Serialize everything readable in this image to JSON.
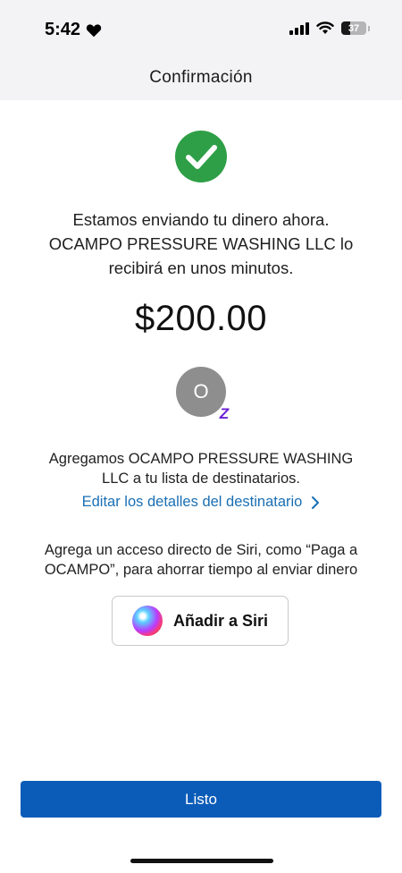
{
  "status_bar": {
    "time": "5:42",
    "battery": "37",
    "icons": [
      "heart-icon",
      "signal-icon",
      "wifi-icon",
      "battery-icon"
    ]
  },
  "nav": {
    "title": "Confirmación"
  },
  "confirmation": {
    "icon": "check-circle-icon",
    "message": "Estamos enviando tu dinero ahora. OCAMPO PRESSURE WASHING LLC lo recibirá en unos minutos.",
    "amount": "$200.00"
  },
  "recipient": {
    "initial": "O",
    "badge_letter": "Z",
    "added_text": "Agregamos OCAMPO PRESSURE WASHING LLC a tu lista de destinatarios.",
    "edit_link": "Editar los detalles del destinatario"
  },
  "siri": {
    "description": "Agrega un acceso directo de Siri, como “Paga a OCAMPO”, para ahorrar tiempo al enviar dinero",
    "button_label": "Añadir a Siri"
  },
  "footer": {
    "done_label": "Listo"
  },
  "colors": {
    "primary": "#0b5cb8",
    "link": "#1a6fb4",
    "success": "#2e9f46",
    "zelle": "#6d1ed4",
    "header_bg": "#f3f3f5"
  }
}
